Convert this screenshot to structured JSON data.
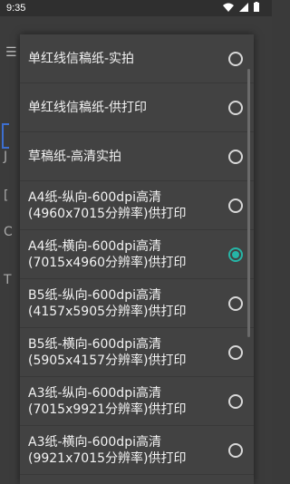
{
  "status_bar": {
    "time": "9:35"
  },
  "dialog": {
    "options": [
      {
        "line1": "单红线信稿纸-实拍",
        "line2": "",
        "selected": false
      },
      {
        "line1": "单红线信稿纸-供打印",
        "line2": "",
        "selected": false
      },
      {
        "line1": "草稿纸-高清实拍",
        "line2": "",
        "selected": false
      },
      {
        "line1": "A4纸-纵向-600dpi高清",
        "line2": "(4960x7015分辨率)供打印",
        "selected": false
      },
      {
        "line1": "A4纸-横向-600dpi高清",
        "line2": "(7015x4960分辨率)供打印",
        "selected": true
      },
      {
        "line1": "B5纸-纵向-600dpi高清",
        "line2": "(4157x5905分辨率)供打印",
        "selected": false
      },
      {
        "line1": "B5纸-横向-600dpi高清",
        "line2": "(5905x4157分辨率)供打印",
        "selected": false
      },
      {
        "line1": "A3纸-纵向-600dpi高清",
        "line2": "(7015x9921分辨率)供打印",
        "selected": false
      },
      {
        "line1": "A3纸-横向-600dpi高清",
        "line2": "(9921x7015分辨率)供打印",
        "selected": false
      }
    ]
  }
}
